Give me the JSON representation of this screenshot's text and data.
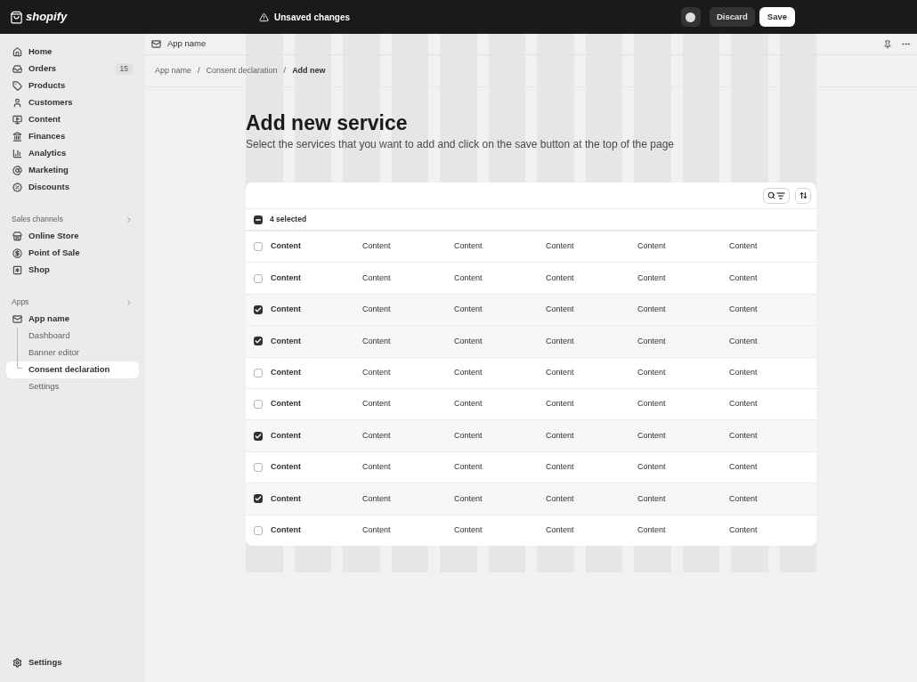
{
  "topbar": {
    "logo": "shopify",
    "status": "Unsaved changes",
    "discard": "Discard",
    "save": "Save"
  },
  "sidebar": {
    "items": [
      {
        "label": "Home",
        "kind": "home",
        "selected": false
      },
      {
        "label": "Orders",
        "kind": "orders",
        "badge": "15",
        "selected": false
      },
      {
        "label": "Products",
        "kind": "products",
        "selected": false
      },
      {
        "label": "Customers",
        "kind": "customers",
        "selected": false
      },
      {
        "label": "Content",
        "kind": "content",
        "selected": false
      },
      {
        "label": "Finances",
        "kind": "finances",
        "selected": false
      },
      {
        "label": "Analytics",
        "kind": "analytics",
        "selected": false
      },
      {
        "label": "Marketing",
        "kind": "marketing",
        "selected": false
      },
      {
        "label": "Discounts",
        "kind": "discounts",
        "selected": false
      }
    ],
    "sections": [
      {
        "title": "Sales channels",
        "items": [
          {
            "label": "Online Store",
            "kind": "store",
            "selected": false
          },
          {
            "label": "Point of Sale",
            "kind": "pos",
            "selected": false
          },
          {
            "label": "Shop",
            "kind": "shop",
            "selected": false
          }
        ]
      },
      {
        "title": "Apps",
        "items": [
          {
            "label": "App name",
            "kind": "app",
            "selected": false,
            "children": [
              {
                "label": "Dashboard",
                "selected": false
              },
              {
                "label": "Banner editor",
                "selected": false
              },
              {
                "label": "Consent declaration",
                "selected": true
              },
              {
                "label": "Settings",
                "selected": false
              }
            ]
          }
        ]
      }
    ],
    "settings": "Settings"
  },
  "appbar": {
    "title": "App name"
  },
  "breadcrumbs": [
    {
      "label": "App name"
    },
    {
      "separator": "/",
      "label": "Consent declaration"
    },
    {
      "separator": "/",
      "label": "Add new"
    }
  ],
  "page": {
    "title": "Add new service",
    "subtitle": "Select the services that you want to add and click on the save button at the top of the page"
  },
  "table": {
    "selection_label": "4 selected",
    "indeterminate": true,
    "rows": [
      {
        "checked": false,
        "cells": [
          "Content",
          "Content",
          "Content",
          "Content",
          "Content",
          "Content"
        ]
      },
      {
        "checked": false,
        "cells": [
          "Content",
          "Content",
          "Content",
          "Content",
          "Content",
          "Content"
        ]
      },
      {
        "checked": true,
        "cells": [
          "Content",
          "Content",
          "Content",
          "Content",
          "Content",
          "Content"
        ]
      },
      {
        "checked": true,
        "cells": [
          "Content",
          "Content",
          "Content",
          "Content",
          "Content",
          "Content"
        ]
      },
      {
        "checked": false,
        "cells": [
          "Content",
          "Content",
          "Content",
          "Content",
          "Content",
          "Content"
        ]
      },
      {
        "checked": false,
        "cells": [
          "Content",
          "Content",
          "Content",
          "Content",
          "Content",
          "Content"
        ]
      },
      {
        "checked": true,
        "cells": [
          "Content",
          "Content",
          "Content",
          "Content",
          "Content",
          "Content"
        ]
      },
      {
        "checked": false,
        "cells": [
          "Content",
          "Content",
          "Content",
          "Content",
          "Content",
          "Content"
        ]
      },
      {
        "checked": true,
        "cells": [
          "Content",
          "Content",
          "Content",
          "Content",
          "Content",
          "Content"
        ]
      },
      {
        "checked": false,
        "cells": [
          "Content",
          "Content",
          "Content",
          "Content",
          "Content",
          "Content"
        ]
      }
    ]
  }
}
